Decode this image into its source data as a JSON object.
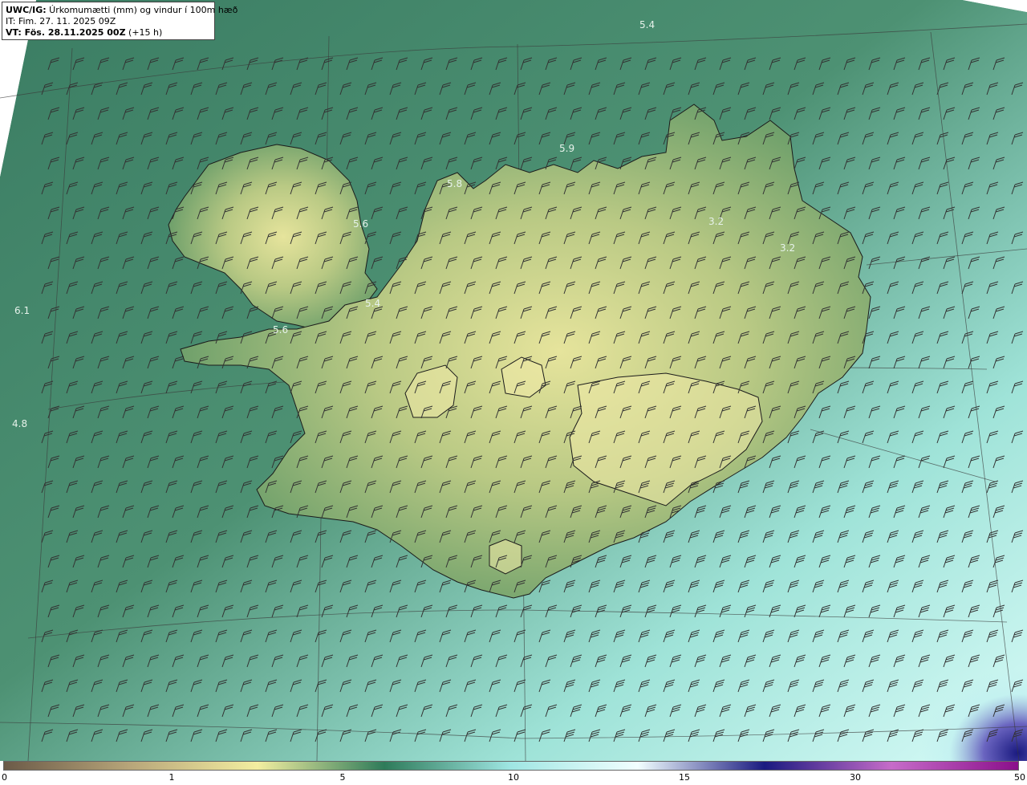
{
  "legend": {
    "model": "UWC/IG:",
    "title": " Úrkomumætti (mm) og vindur í 100m hæð",
    "it_label": "IT:",
    "it_value": " Fim. 27. 11. 2025 09Z",
    "vt_label": "VT:",
    "vt_value": " Fös. 28.11.2025 00Z",
    "vt_lead": " (+15 h)"
  },
  "map_labels": [
    "5.4",
    "5.9",
    "5.8",
    "5.6",
    "3.2",
    "3.2",
    "5.4",
    "5.6",
    "6.1",
    "4.8"
  ],
  "colorbar": {
    "ticks": [
      "0",
      "1",
      "5",
      "10",
      "15",
      "30",
      "50"
    ],
    "colors": [
      "#6b5a48",
      "#b8a67a",
      "#f3eea0",
      "#2e7b5a",
      "#9fe6e3",
      "#f2ffff",
      "#1a1a80",
      "#c66cc9",
      "#8a0f8a"
    ]
  },
  "palette": {
    "ocean_west": "#3f7d66",
    "ocean_north": "#4a8a6a",
    "ocean_south": "#8fdcd4",
    "ocean_southeast": "#bff2ee",
    "land_high": "#e9e49a",
    "land_low": "#6f9f69",
    "deep_purple": "#2a1f8a",
    "coast": "#1b1b1b",
    "barb": "#333333"
  }
}
